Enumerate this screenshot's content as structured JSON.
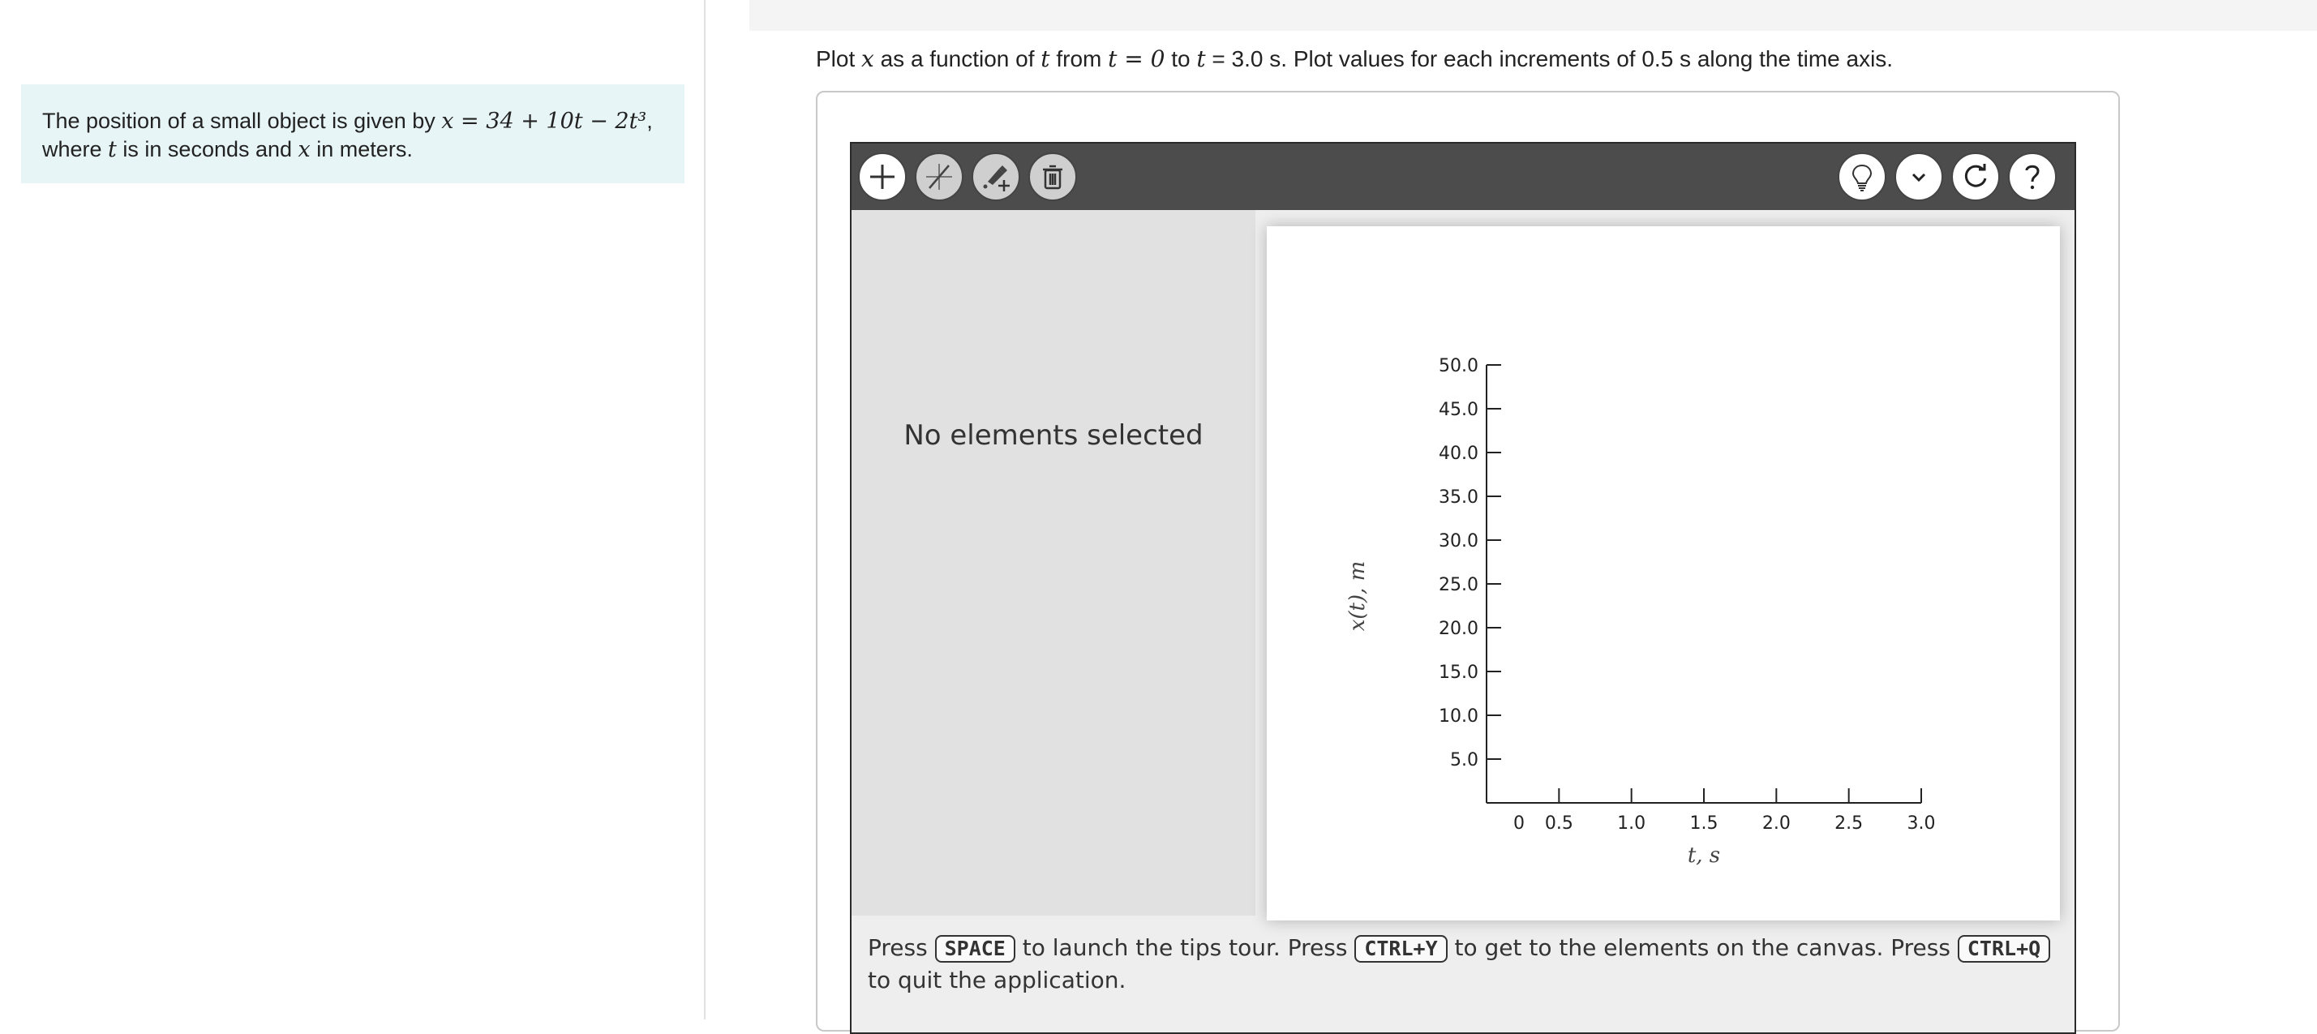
{
  "problem": {
    "text_before": "The position of a small object is given by ",
    "equation": "x = 34 + 10t − 2t³",
    "text_after": ",",
    "line2_before": "where ",
    "var_t": "t",
    "line2_mid": " is in seconds and ",
    "var_x": "x",
    "line2_after": " in meters."
  },
  "prompt": {
    "p1": "Plot ",
    "x": "x",
    "p2": " as a function of ",
    "t": "t",
    "p3": " from ",
    "t0": "t = 0",
    "p4": " to ",
    "t1": "t",
    "p5": " = 3.0 s. Plot values for each increments of 0.5 s along the time axis."
  },
  "toolbar": {
    "left_icons": [
      "plus-icon",
      "line-tool-icon",
      "marker-add-icon",
      "trash-icon"
    ],
    "right_icons": [
      "hint-lightbulb-icon",
      "chevron-down-icon",
      "reset-icon",
      "help-icon"
    ]
  },
  "side_panel": {
    "empty_text": "No elements selected"
  },
  "chart_data": {
    "type": "scatter",
    "xlabel": "t, s",
    "ylabel": "x(t), m",
    "xlim": [
      0,
      3.0
    ],
    "ylim": [
      0,
      50.0
    ],
    "x_ticks": [
      "0",
      "0.5",
      "1.0",
      "1.5",
      "2.0",
      "2.5",
      "3.0"
    ],
    "y_ticks": [
      "5.0",
      "10.0",
      "15.0",
      "20.0",
      "25.0",
      "30.0",
      "35.0",
      "40.0",
      "45.0",
      "50.0"
    ],
    "series": []
  },
  "footer": {
    "press1": "Press ",
    "key1": "SPACE",
    "mid1": " to launch the tips tour. Press ",
    "key2": "CTRL+Y",
    "mid2": " to get to the elements on the canvas. Press ",
    "key3": "CTRL+Q",
    "end": " to quit the application."
  },
  "colors": {
    "toolbar": "#4c4c4c",
    "problem_bg": "#e8f5f7",
    "panel": "#e1e1e1"
  }
}
